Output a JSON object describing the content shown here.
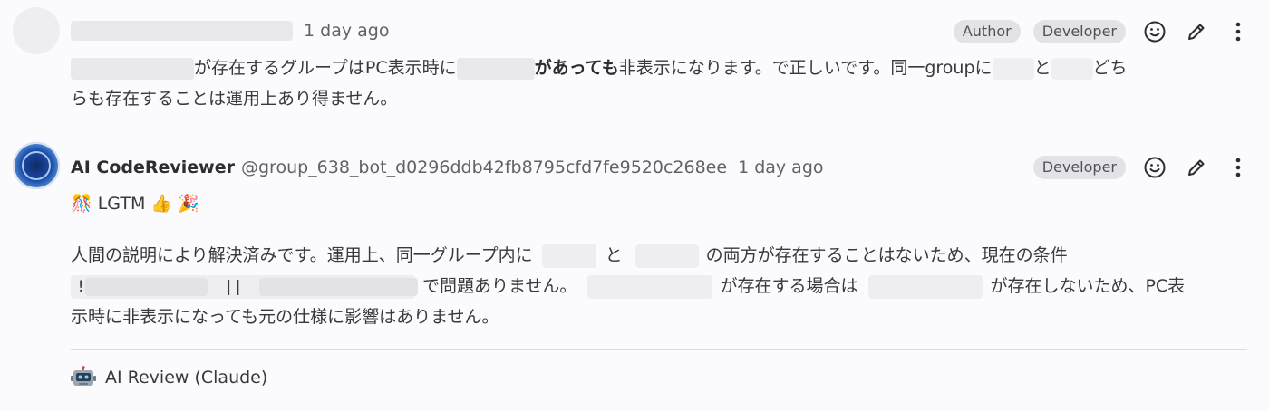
{
  "note1": {
    "time": "1 day ago",
    "badges": {
      "author": "Author",
      "developer": "Developer"
    },
    "line1": {
      "a": "が存在するグループはPC表示時に",
      "b_bold": "があっても",
      "c": "非表示になります。で正しいです。同一groupに",
      "d": "と",
      "e": "どち"
    },
    "line2": "らも存在することは運用上あり得ません。"
  },
  "note2": {
    "author_name": "AI CodeReviewer",
    "handle": "@group_638_bot_d0296ddb42fb8795cfd7fe9520c268ee",
    "time": "1 day ago",
    "badges": {
      "developer": "Developer"
    },
    "lgtm_line": {
      "emoji1": "🎊",
      "text": "LGTM",
      "emoji2": "👍",
      "emoji3": "🎉"
    },
    "para1": {
      "a": "人間の説明により解決済みです。運用上、同一グループ内に",
      "b": "と",
      "c": "の両方が存在することはないため、現在の条件"
    },
    "para2": {
      "bang": "!",
      "op": "||",
      "a": "で問題ありません。",
      "b": "が存在する場合は",
      "c": "が存在しないため、PC表"
    },
    "para3": "示時に非表示になっても元の仕様に影響はありません。",
    "footer": "AI Review (Claude)"
  },
  "icons": [
    "smiley-icon",
    "pencil-icon",
    "more-vertical-icon",
    "robot-icon"
  ],
  "colors": {
    "background": "#fbfafd",
    "badge_bg": "#e3e2e7",
    "text": "#3a383f"
  }
}
